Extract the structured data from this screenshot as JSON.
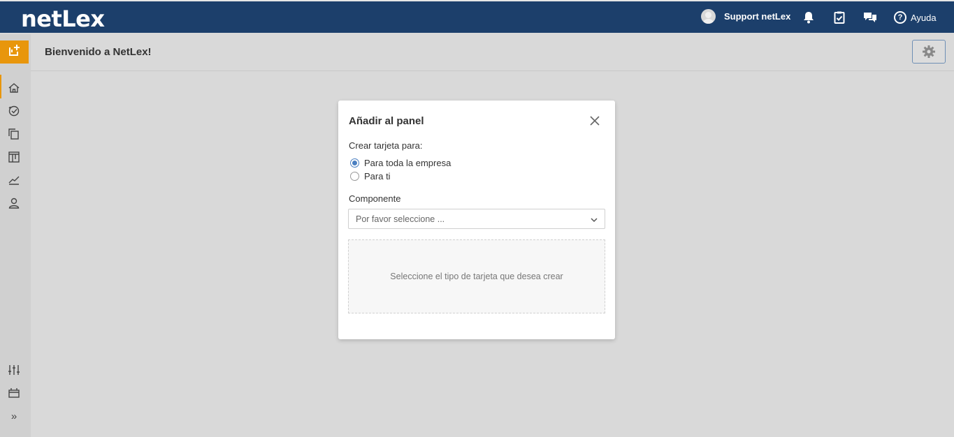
{
  "topbar": {
    "logo": "netLex",
    "user_name": "Support netLex",
    "help_label": "Ayuda",
    "help_glyph": "?",
    "icons": [
      "user-avatar-icon",
      "bell-icon",
      "clipboard-check-icon",
      "chat-icon",
      "help-circle-icon"
    ],
    "bg_color": "#1c3f6b"
  },
  "sidebar": {
    "accent_color": "#e8960c",
    "add_icon": "add-card-icon",
    "items": [
      "home-icon",
      "tasks-icon",
      "documents-icon",
      "kanban-icon",
      "chart-icon",
      "user-icon"
    ],
    "bottom_items": [
      "sliders-icon",
      "calendar-icon",
      "expand-icon"
    ],
    "expand_glyph": "»"
  },
  "header": {
    "title": "Bienvenido a NetLex!",
    "settings_icon": "gear-icon"
  },
  "modal": {
    "title": "Añadir al panel",
    "create_label": "Crear tarjeta para:",
    "options": [
      {
        "label": "Para toda la empresa",
        "checked": true
      },
      {
        "label": "Para ti",
        "checked": false
      }
    ],
    "component_label": "Componente",
    "select_placeholder": "Por favor seleccione ...",
    "empty_message": "Seleccione el tipo de tarjeta que desea crear"
  }
}
